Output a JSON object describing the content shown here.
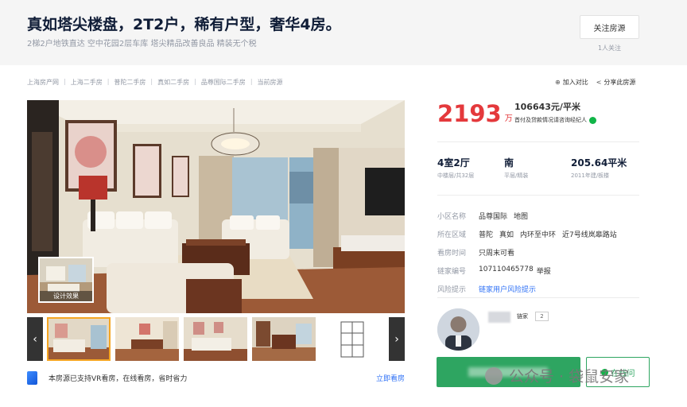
{
  "header": {
    "title": "真如塔尖楼盘，2T2户，稀有户型，奢华4房。",
    "subtitle": "2梯2户地铁直达 空中花园2层车库 塔尖精品改善良品 精装无个税",
    "follow_label": "关注房源",
    "follow_count": "1人关注"
  },
  "breadcrumb": [
    "上海房产网",
    "上海二手房",
    "普陀二手房",
    "真如二手房",
    "品尊国际二手房",
    "当前房源"
  ],
  "tools": {
    "compare_label": "加入对比",
    "share_label": "分享此房源"
  },
  "gallery": {
    "vr_thumb_label": "设计效果",
    "prev_label": "‹",
    "next_label": "›",
    "thumbs": [
      "living-room",
      "dining-room",
      "living-room-2",
      "dining-room-2",
      "floor-plan"
    ]
  },
  "vr_bar": {
    "text": "本房源已支持VR看房，在线看房，省时省力",
    "link": "立即看房"
  },
  "price": {
    "total": "2193",
    "unit": "万",
    "per_sqm": "106643元/平米",
    "note": "首付及贷款情况请咨询经纪人"
  },
  "facts": [
    {
      "main": "4室2厅",
      "sub": "中楼层/共32层"
    },
    {
      "main": "南",
      "sub": "平层/精装"
    },
    {
      "main": "205.64平米",
      "sub": "2011年建/板楼"
    }
  ],
  "info": {
    "community_label": "小区名称",
    "community_name": "品尊国际",
    "community_map": "地图",
    "area_label": "所在区域",
    "area_district": "普陀",
    "area_block": "真如",
    "area_ring": "内环至中环",
    "area_subway": "近7号线岚皋路站",
    "visit_label": "看房时间",
    "visit_value": "只周末可看",
    "id_label": "链家编号",
    "id_value": "107110465778",
    "id_report": "举报",
    "risk_label": "风险提示",
    "risk_value": "链家用户风险提示"
  },
  "agent": {
    "badge": "链家",
    "level": "2"
  },
  "buttons": {
    "online_label": "在线问"
  },
  "watermark": "公众号 · 袋鼠安家",
  "colors": {
    "price_red": "#e4393c",
    "primary_green": "#2ea561",
    "link_blue": "#3072f6"
  }
}
